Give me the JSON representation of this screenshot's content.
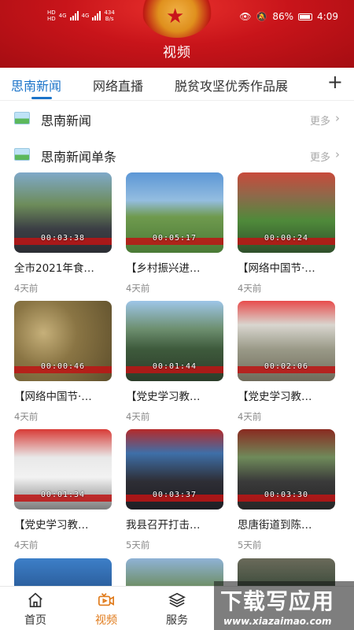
{
  "status_bar": {
    "left_sig_1": "HD",
    "left_sig_2": "HD",
    "net_1": "4G",
    "net_2": "4G",
    "speed_value": "434",
    "speed_unit": "B/s",
    "battery_percent": "86%",
    "time": "4:09"
  },
  "header": {
    "title": "视频"
  },
  "tabs": [
    {
      "label": "思南新闻",
      "active": true
    },
    {
      "label": "网络直播"
    },
    {
      "label": "脱贫攻坚优秀作品展"
    }
  ],
  "tab_add": "+",
  "sections": [
    {
      "title": "思南新闻",
      "more": "更多"
    },
    {
      "title": "思南新闻单条",
      "more": "更多"
    }
  ],
  "videos": [
    {
      "title": "全市2021年食…",
      "time": "4天前",
      "duration": "00:03:38"
    },
    {
      "title": "【乡村振兴进…",
      "time": "4天前",
      "duration": "00:05:17"
    },
    {
      "title": "【网络中国节·…",
      "time": "4天前",
      "duration": "00:00:24"
    },
    {
      "title": "【网络中国节·…",
      "time": "4天前",
      "duration": "00:00:46"
    },
    {
      "title": "【党史学习教…",
      "time": "4天前",
      "duration": "00:01:44"
    },
    {
      "title": "【党史学习教…",
      "time": "4天前",
      "duration": "00:02:06"
    },
    {
      "title": "【党史学习教…",
      "time": "4天前",
      "duration": "00:01:34"
    },
    {
      "title": "我县召开打击…",
      "time": "5天前",
      "duration": "00:03:37"
    },
    {
      "title": "思唐街道到陈…",
      "time": "5天前",
      "duration": "00:03:30"
    }
  ],
  "bottom_nav": [
    {
      "label": "首页",
      "icon": "home-icon"
    },
    {
      "label": "视频",
      "icon": "video-icon",
      "active": true
    },
    {
      "label": "服务",
      "icon": "layers-icon"
    }
  ],
  "watermark": {
    "main": "下载写应用",
    "url": "www.xiazaimao.com"
  },
  "colors": {
    "accent": "#1a73c9",
    "nav_active": "#e07a1a",
    "header_red": "#c8141a"
  }
}
